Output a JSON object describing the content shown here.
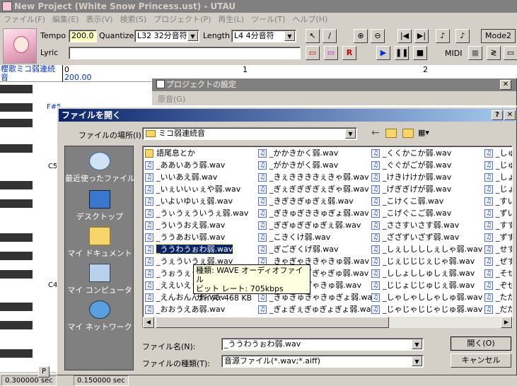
{
  "window": {
    "title": "New Project (White Snow Princess.ust) - UTAU"
  },
  "menu": [
    "ファイル(F)",
    "編集(E)",
    "表示(V)",
    "検索(S)",
    "プロジェクト(P)",
    "再生(L)",
    "ツール(T)",
    "ヘルプ(H)"
  ],
  "toolbar": {
    "tempo_label": "Tempo",
    "tempo_value": "200.0",
    "quantize_label": "Quantize",
    "quantize_value": "L32 32分音符",
    "length_label": "Length",
    "length_value": "L4  4分音符",
    "lyric_label": "Lyric",
    "lyric_value": "",
    "mode_label": "Mode2",
    "midi_label": "MIDI"
  },
  "ruler": {
    "track_name": "櫻歌ミコ弱連続音",
    "tempo_mark": "200.00",
    "measures": [
      "0",
      "1",
      "2"
    ]
  },
  "piano": {
    "labels": [
      "F#5",
      "C5",
      "C4"
    ]
  },
  "status": {
    "left": "0.300000 sec",
    "right": "0.150000 sec"
  },
  "settings_panel": {
    "title": "プロジェクトの設定",
    "row_label": "原音(G)"
  },
  "dialog": {
    "title": "ファイルを開く",
    "location_label": "ファイルの場所(I):",
    "location_value": "ミコ弱連続音",
    "places": [
      "最近使ったファイル",
      "デスクトップ",
      "マイ ドキュメント",
      "マイ コンピュータ",
      "マイ ネットワーク"
    ],
    "columns": [
      [
        "語尾息とか",
        "_ああいあう弱.wav",
        "_いいあえ弱.wav",
        "_いぇいいぃぇや弱.wav",
        "_いよいゆいぇ弱.wav",
        "_うぃうぇういうぇ弱.wav",
        "_ういうおえ弱.wav",
        "_ううあおい弱.wav",
        "_ううわうぉわ弱.wav",
        "_うぇういうぇ弱.wav",
        "_うぉうぇうぉ弱.wav",
        "_ええいえう弱.wav",
        "_えんおんん弱.wav",
        "_おおうえあ弱.wav"
      ],
      [
        "_かかきかく弱.wav",
        "_がかきがく弱.wav",
        "_きぇききききぇきゃ弱.wav",
        "_ぎぇぎぎぎぎぇぎゃ弱.wav",
        "_きぎきぎゅぎぇ弱.wav",
        "_ぎきゅぎききゅぎょ弱.wav",
        "_ぎぎゅぎぎゅぎぇ弱.wav",
        "_こきくけ弱.wav",
        "_ぎごぎくげ弱.wav",
        "_きゃぎゃききゃきゅ弱.wav",
        "_ぎゃぎゃぎぎゃぎゅ弱.wav",
        "_きゃきゃぎゃきゅ弱.wav",
        "_きゅきゅきゃきゅぎょ弱.wav",
        "_ぎょぎぇぎゅぎょぎょ弱.wav"
      ],
      [
        "_くくかこか弱.wav",
        "_ぐぐがごが弱.wav",
        "_けきけけか弱.wav",
        "_げぎぎげが弱.wav",
        "_こけくこ弱.wav",
        "_こげぐこご弱.wav",
        "_ささすいさす弱.wav",
        "_ざざずいざず弱.wav",
        "_しぇししししぇしゃ弱.wav",
        "_じぇじじじぇじゃ弱.wav",
        "_ししょししゅしぇ弱.wav",
        "_じじょじじゅじぇ弱.wav",
        "_しゃしゃししゃしゅ弱.wav",
        "_じゃじゃじじゃじゅ弱.wav"
      ],
      [
        "_しゅ",
        "_じゅ",
        "_しょ",
        "_じょ",
        "_すい",
        "_ずい",
        "_すす",
        "_ずず",
        "_せす",
        "_ぜず",
        "_そせ",
        "_ぞぜ",
        "_ただ",
        "_だだ"
      ]
    ],
    "selected_file": "_ううわうぉわ弱.wav",
    "tooltip": {
      "type_line": "種類: WAVE オーディオファイル",
      "bitrate_line": "ビット レート: 705kbps",
      "size_line": "サイズ: 468 KB"
    },
    "filename_label": "ファイル名(N):",
    "filename_value": "_ううわうぉわ弱.wav",
    "filetype_label": "ファイルの種類(T):",
    "filetype_value": "音源ファイル(*.wav;*.aiff)",
    "open_button": "開く(O)",
    "cancel_button": "キャンセル"
  }
}
